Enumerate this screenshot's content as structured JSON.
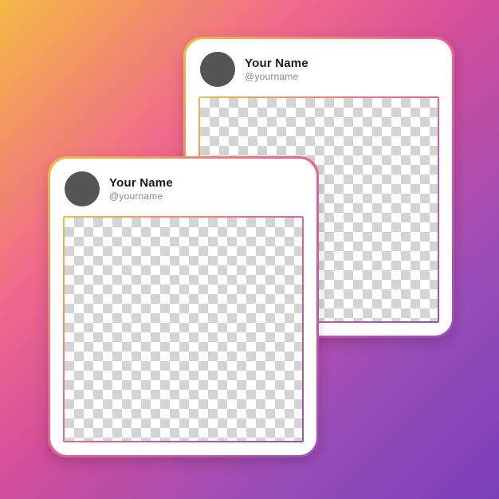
{
  "cards": [
    {
      "display_name": "Your Name",
      "handle": "@yourname"
    },
    {
      "display_name": "Your Name",
      "handle": "@yourname"
    }
  ]
}
